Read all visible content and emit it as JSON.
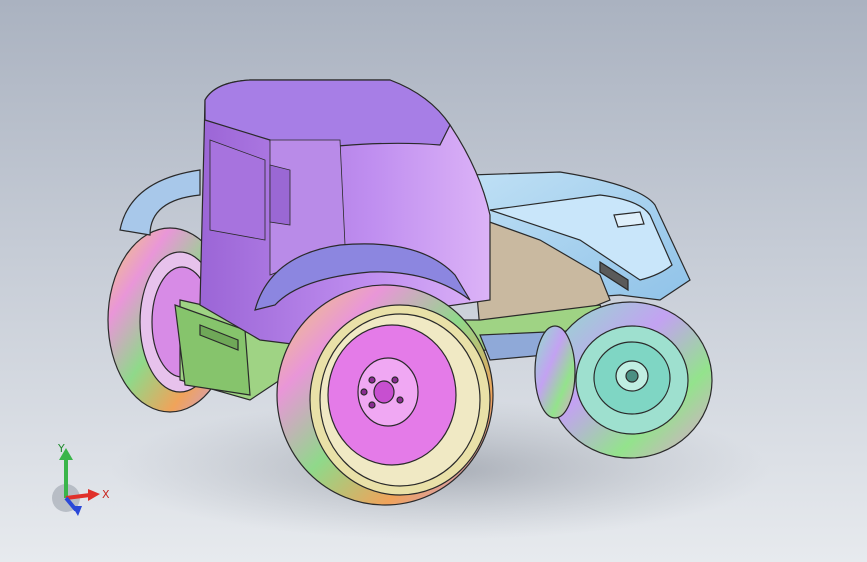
{
  "viewport": {
    "colors": {
      "background_top": "#aab2c0",
      "background_bottom": "#e7eaee",
      "cab": "#b07ae0",
      "hood": "#a9d1ee",
      "frame": "#9fd384",
      "fender": "#8c86e0",
      "engine_panel": "#c9b9a0",
      "rear_rim": "#e47be8",
      "front_rim": "#7fd6c4"
    }
  },
  "triad": {
    "x_label": "X",
    "y_label": "Y",
    "colors": {
      "x": "#e0302a",
      "y": "#3ab54a",
      "z": "#2a48d8"
    }
  }
}
